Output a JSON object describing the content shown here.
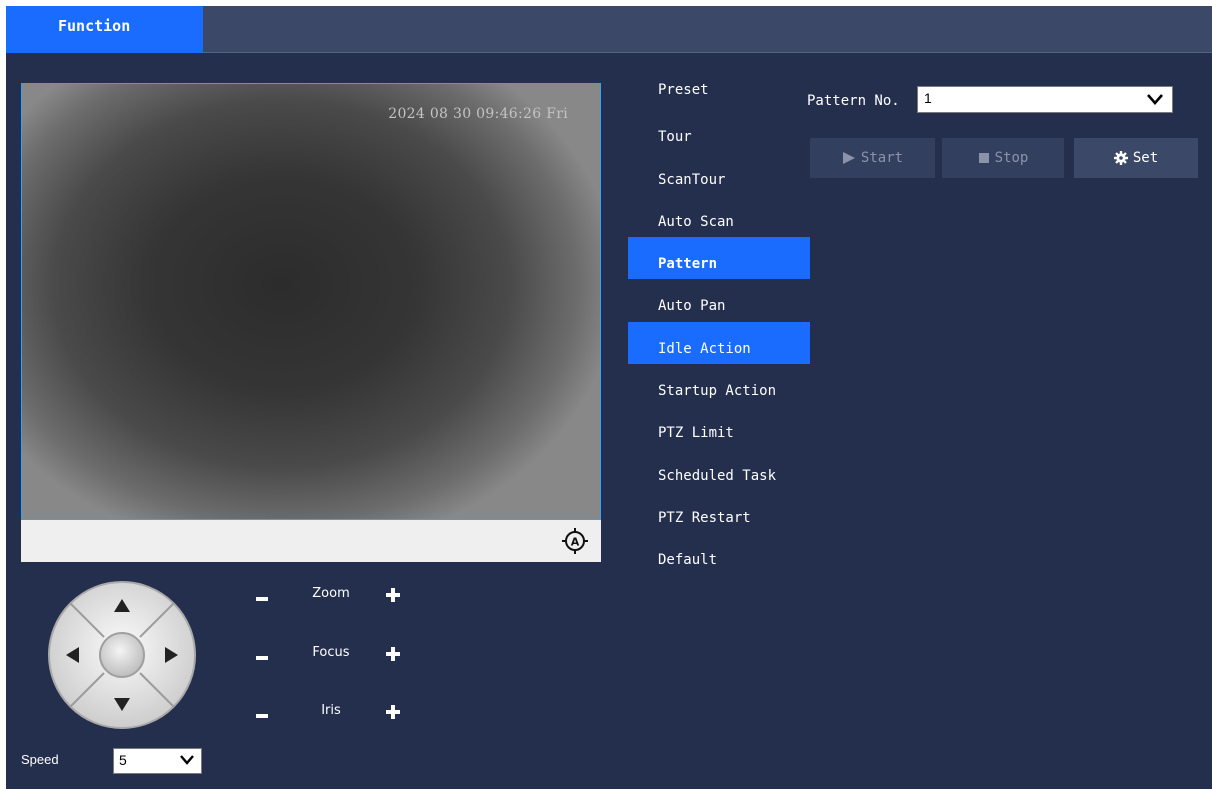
{
  "topbar": {
    "tab_label": "Function"
  },
  "video": {
    "osd_text": "2024 08 30 09:46:26 Fri",
    "ptz_ctrl_icon": "target-a-icon"
  },
  "lens": {
    "zoom_label": "Zoom",
    "focus_label": "Focus",
    "iris_label": "Iris"
  },
  "speed": {
    "label": "Speed",
    "value": "5"
  },
  "menu": {
    "items": [
      {
        "label": "Preset"
      },
      {
        "label": "Tour"
      },
      {
        "label": "ScanTour"
      },
      {
        "label": "Auto Scan"
      },
      {
        "label": "Pattern"
      },
      {
        "label": "Auto Pan"
      },
      {
        "label": "Idle Action"
      },
      {
        "label": "Startup Action"
      },
      {
        "label": "PTZ Limit"
      },
      {
        "label": "Scheduled Task"
      },
      {
        "label": "PTZ Restart"
      },
      {
        "label": "Default"
      }
    ],
    "active_item": "Pattern",
    "hover_item": "Idle Action"
  },
  "pattern": {
    "label": "Pattern No.",
    "value": "1",
    "start_label": "Start",
    "stop_label": "Stop",
    "set_label": "Set"
  },
  "colors": {
    "accent": "#1a6cff",
    "background": "#242f4e",
    "topbar": "#3b4868"
  }
}
